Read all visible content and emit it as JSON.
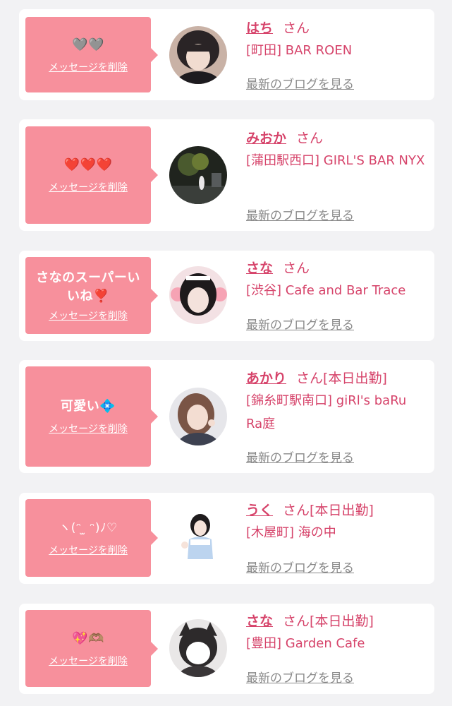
{
  "common": {
    "delete_label": "メッセージを削除",
    "san": "さん",
    "blog_label": "最新のブログを見る"
  },
  "items": [
    {
      "message": "🩶🩶",
      "name": "はち",
      "badge": "",
      "shop": "[町田] BAR ROEN"
    },
    {
      "message": "❤️❤️❤️",
      "name": "みおか",
      "badge": "",
      "shop": "[蒲田駅西口] GIRL'S BAR NYX"
    },
    {
      "message": "さなのスーパーいいね❣️",
      "name": "さな",
      "badge": "",
      "shop": "[渋谷] Cafe and Bar Trace"
    },
    {
      "message": "可愛い💠",
      "name": "あかり",
      "badge": "[本日出勤]",
      "shop": "[錦糸町駅南口] giRl's baRuRa庭"
    },
    {
      "message": "ヽ(ᵔ ̫ ᵔ)ﾉ♡",
      "name": "うく",
      "badge": "[本日出勤]",
      "shop": "[木屋町] 海の中"
    },
    {
      "message": "💖🫶🏽",
      "name": "さな",
      "badge": "[本日出勤]",
      "shop": "[豊田] Garden Cafe"
    }
  ],
  "colors": {
    "bubble": "#f7909c",
    "accent": "#d6436a",
    "link_gray": "#8a8a8a",
    "background": "#f2f2f4"
  }
}
